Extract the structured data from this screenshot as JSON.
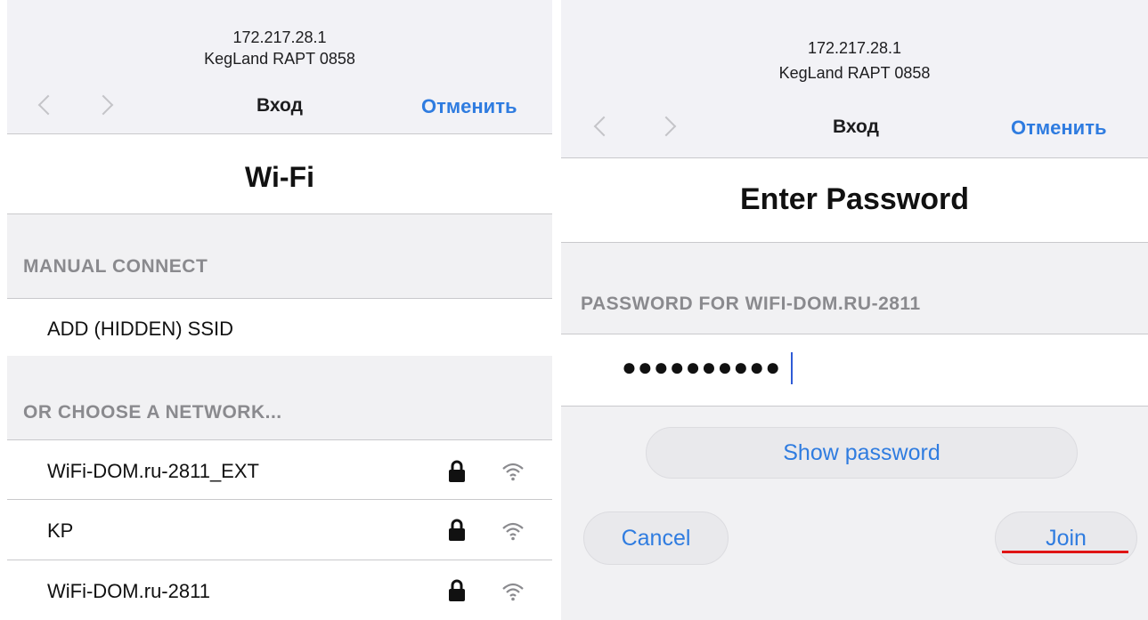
{
  "header": {
    "ip": "172.217.28.1",
    "device": "KegLand RAPT 0858",
    "title": "Вход",
    "cancel_label": "Отменить"
  },
  "wifi_screen": {
    "title": "Wi-Fi",
    "manual_section": "MANUAL CONNECT",
    "add_hidden_label": "ADD (HIDDEN) SSID",
    "choose_section": "OR CHOOSE A NETWORK...",
    "networks": [
      {
        "ssid": "WiFi-DOM.ru-2811_EXT",
        "secured": true,
        "icon": "lock-icon",
        "signal_icon": "wifi-icon"
      },
      {
        "ssid": "KP",
        "secured": true,
        "icon": "lock-icon",
        "signal_icon": "wifi-icon"
      },
      {
        "ssid": "WiFi-DOM.ru-2811",
        "secured": true,
        "icon": "lock-icon",
        "signal_icon": "wifi-icon"
      }
    ]
  },
  "password_screen": {
    "title": "Enter Password",
    "field_label": "PASSWORD FOR WIFI-DOM.RU-2811",
    "password_value": "●●●●●●●●●●",
    "show_password_label": "Show password",
    "cancel_label": "Cancel",
    "join_label": "Join"
  },
  "colors": {
    "accent": "#2f7ce0",
    "highlight_underline": "#e01414",
    "caret": "#2f5bd6"
  }
}
